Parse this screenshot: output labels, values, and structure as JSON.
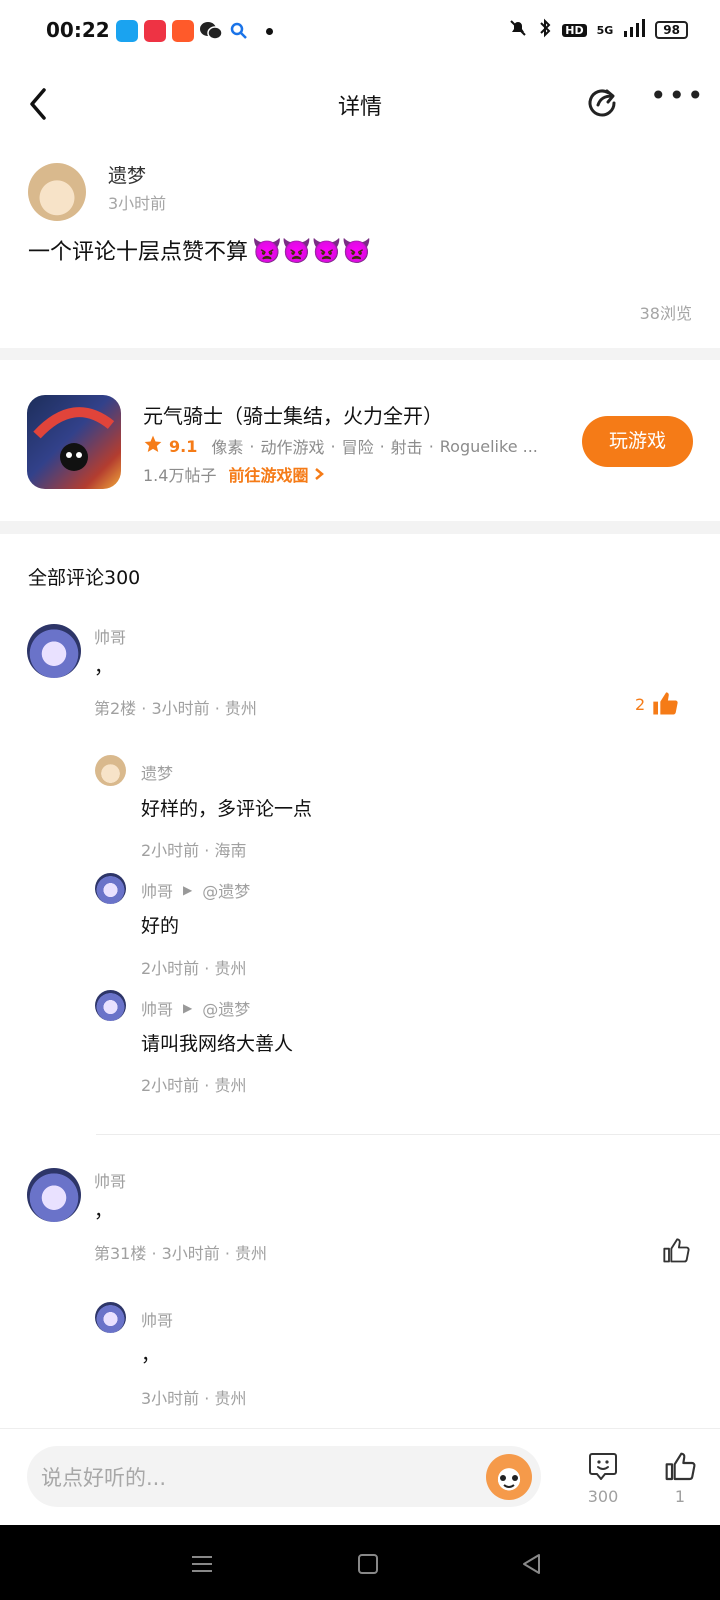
{
  "status_bar": {
    "time": "00:22",
    "network": "5G",
    "hd": "HD",
    "battery": "98"
  },
  "header": {
    "title": "详情"
  },
  "post": {
    "author": "遗梦",
    "time": "3小时前",
    "content": "一个评论十层点赞不算",
    "emoji": "👿👿👿👿",
    "views": "38浏览"
  },
  "game": {
    "name": "元气骑士（骑士集结，火力全开）",
    "rating": "9.1",
    "tags": [
      "像素",
      "动作游戏",
      "冒险",
      "射击",
      "Roguelike ..."
    ],
    "posts": "1.4万帖子",
    "goto_label": "前往游戏圈",
    "play_label": "玩游戏"
  },
  "comments_header": "全部评论300",
  "comments": [
    {
      "author": "帅哥",
      "text": "，",
      "meta": "第2楼 · 3小时前 · 贵州",
      "likes": "2",
      "replies": [
        {
          "author": "遗梦",
          "reply_to": "",
          "text": "好样的，多评论一点",
          "meta": "2小时前 · 海南"
        },
        {
          "author": "帅哥",
          "reply_to": "@遗梦",
          "text": "好的",
          "meta": "2小时前 · 贵州"
        },
        {
          "author": "帅哥",
          "reply_to": "@遗梦",
          "text": "请叫我网络大善人",
          "meta": "2小时前 · 贵州"
        }
      ]
    },
    {
      "author": "帅哥",
      "text": "，",
      "meta": "第31楼 · 3小时前 · 贵州",
      "likes": "",
      "replies": [
        {
          "author": "帅哥",
          "reply_to": "",
          "text": "，",
          "meta": "3小时前 · 贵州"
        }
      ]
    }
  ],
  "bottom_bar": {
    "input_placeholder": "说点好听的...",
    "comment_count": "300",
    "like_count": "1"
  },
  "colors": {
    "accent": "#f57b17",
    "text": "#111111",
    "muted": "#a0a0a0"
  }
}
